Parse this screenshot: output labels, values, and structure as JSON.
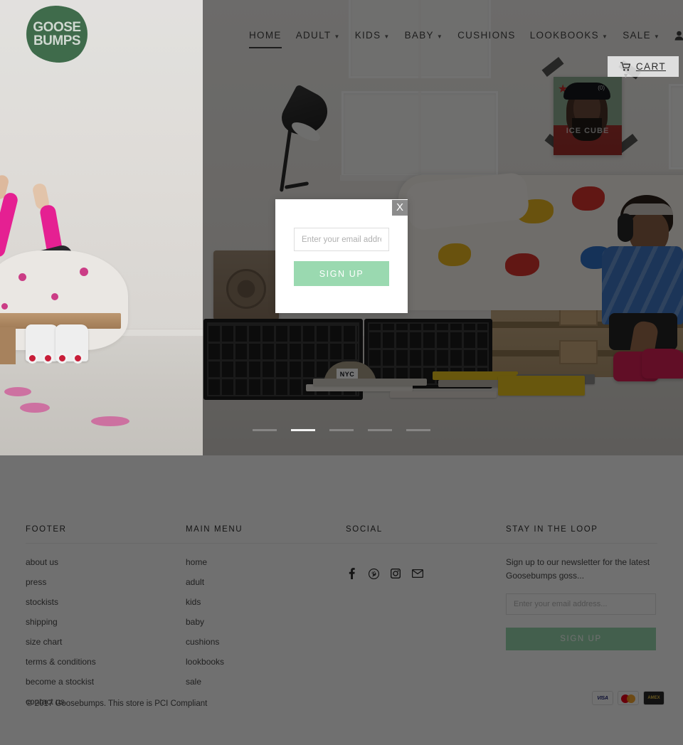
{
  "brand": {
    "name_line1": "GOOSE",
    "name_line2": "BUMPS",
    "logo_color": "#3f6b4b"
  },
  "header": {
    "nav": [
      {
        "label": "HOME",
        "active": true,
        "dropdown": false
      },
      {
        "label": "ADULT",
        "active": false,
        "dropdown": true
      },
      {
        "label": "KIDS",
        "active": false,
        "dropdown": true
      },
      {
        "label": "BABY",
        "active": false,
        "dropdown": true
      },
      {
        "label": "CUSHIONS",
        "active": false,
        "dropdown": false
      },
      {
        "label": "LOOKBOOKS",
        "active": false,
        "dropdown": true
      },
      {
        "label": "SALE",
        "active": false,
        "dropdown": true
      }
    ],
    "account_icon": "user-icon",
    "search_icon": "search-icon",
    "cart": {
      "label": "CART",
      "icon": "shopping-cart-icon",
      "caret": "▼"
    }
  },
  "hero": {
    "carousel": {
      "slide_count": 5,
      "active_index": 2
    }
  },
  "modal": {
    "close_label": "X",
    "email_placeholder": "Enter your email address...",
    "email_value": "",
    "signup_label": "SIGN UP",
    "accent_color": "#9ad9b0"
  },
  "footer": {
    "columns": [
      {
        "heading": "FOOTER",
        "links": [
          "about us",
          "press",
          "stockists",
          "shipping",
          "size chart",
          "terms & conditions",
          "become a stockist",
          "contact us"
        ]
      },
      {
        "heading": "MAIN MENU",
        "links": [
          "home",
          "adult",
          "kids",
          "baby",
          "cushions",
          "lookbooks",
          "sale"
        ]
      }
    ],
    "social": {
      "heading": "SOCIAL",
      "icons": [
        "facebook-icon",
        "pinterest-icon",
        "instagram-icon",
        "email-icon"
      ]
    },
    "newsletter": {
      "heading": "STAY IN THE LOOP",
      "text": "Sign up to our newsletter for the latest Goosebumps goss...",
      "email_placeholder": "Enter your email address...",
      "email_value": "",
      "signup_label": "SIGN UP"
    },
    "copyright": "© 2017 Goosebumps. This store is PCI Compliant",
    "payments": [
      {
        "name": "visa-card-icon",
        "label": "VISA"
      },
      {
        "name": "mastercard-icon",
        "label": ""
      },
      {
        "name": "amex-card-icon",
        "label": "AMEX"
      }
    ]
  }
}
